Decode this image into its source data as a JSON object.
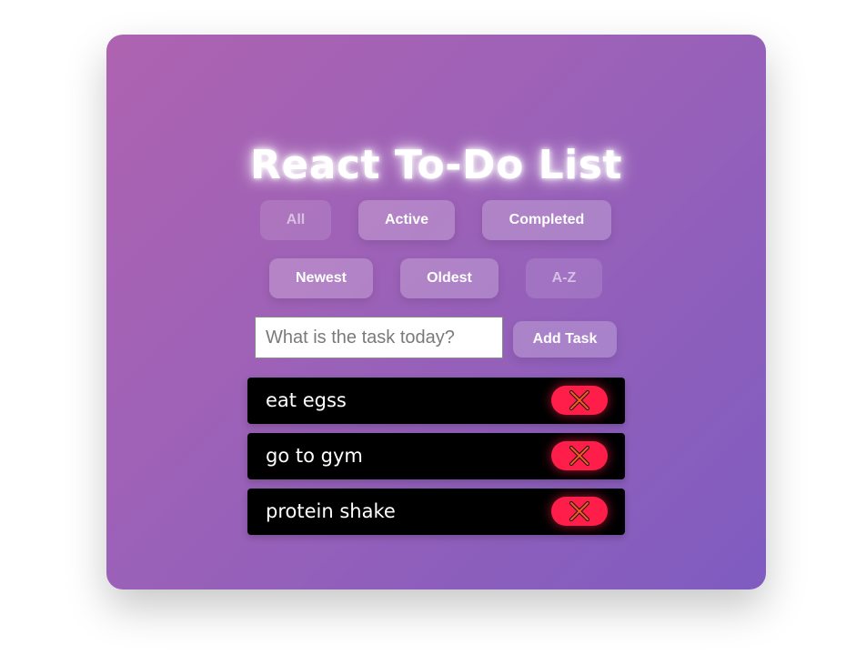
{
  "app": {
    "title": "React To-Do List"
  },
  "filters": [
    {
      "label": "All",
      "active": false
    },
    {
      "label": "Active",
      "active": true
    },
    {
      "label": "Completed",
      "active": true
    }
  ],
  "sorts": [
    {
      "label": "Newest",
      "active": true
    },
    {
      "label": "Oldest",
      "active": true
    },
    {
      "label": "A-Z",
      "active": false
    }
  ],
  "new_task": {
    "value": "",
    "placeholder": "What is the task today?",
    "add_label": "Add Task"
  },
  "tasks": [
    {
      "text": "eat egss",
      "delete_icon": "close-x-icon"
    },
    {
      "text": "go to gym",
      "delete_icon": "close-x-icon"
    },
    {
      "text": "protein shake",
      "delete_icon": "close-x-icon"
    }
  ],
  "colors": {
    "accent_gradient_start": "#ae63b0",
    "accent_gradient_end": "#7f5cc0",
    "delete_button": "#ff1e4a",
    "task_background": "#000000"
  }
}
